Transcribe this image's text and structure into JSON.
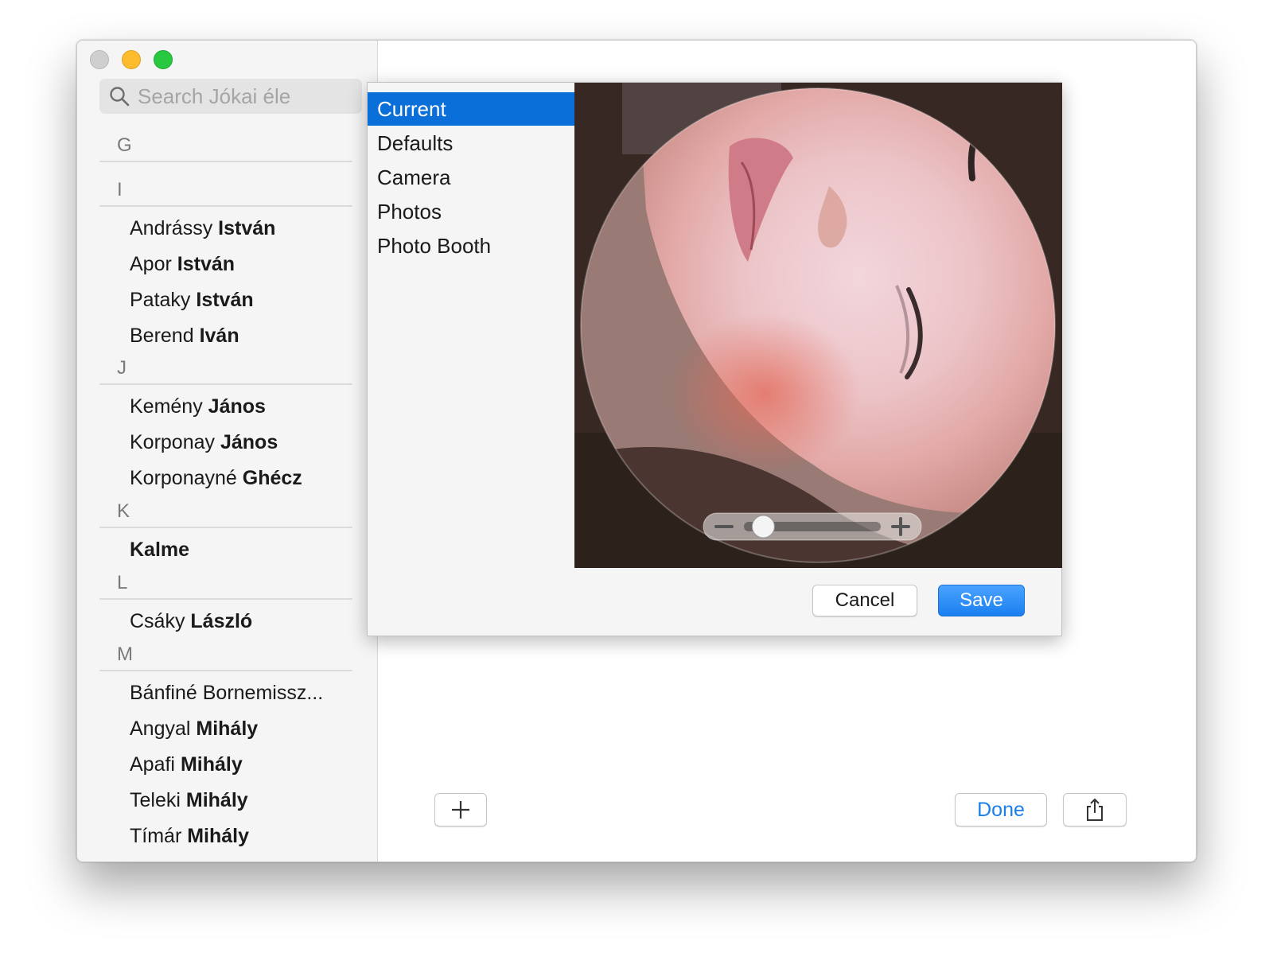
{
  "search": {
    "placeholder": "Search Jókai éle"
  },
  "contacts": {
    "sections": [
      {
        "letter": "G",
        "entries": []
      },
      {
        "letter": "I",
        "entries": [
          {
            "first": "Andrássy ",
            "last": "István"
          },
          {
            "first": "Apor ",
            "last": "István"
          },
          {
            "first": "Pataky ",
            "last": "István"
          },
          {
            "first": "Berend ",
            "last": "Iván"
          }
        ]
      },
      {
        "letter": "J",
        "entries": [
          {
            "first": "Kemény ",
            "last": "János"
          },
          {
            "first": "Korponay ",
            "last": "János"
          },
          {
            "first": "Korponayné ",
            "last": "Ghécz"
          }
        ]
      },
      {
        "letter": "K",
        "entries": [
          {
            "first": "",
            "last": "Kalme"
          }
        ]
      },
      {
        "letter": "L",
        "entries": [
          {
            "first": "Csáky ",
            "last": "László"
          }
        ]
      },
      {
        "letter": "M",
        "entries": [
          {
            "first": "Bánfiné Bornemissz...",
            "last": ""
          },
          {
            "first": "Angyal ",
            "last": "Mihály"
          },
          {
            "first": "Apafi ",
            "last": "Mihály"
          },
          {
            "first": "Teleki ",
            "last": "Mihály"
          },
          {
            "first": "Tímár ",
            "last": "Mihály"
          }
        ]
      }
    ]
  },
  "picker": {
    "sources": [
      "Current",
      "Defaults",
      "Camera",
      "Photos",
      "Photo Booth"
    ],
    "selected_index": 0,
    "zoom_level": 0.1,
    "zoom_minus_icon": "minus",
    "zoom_plus_icon": "plus",
    "cancel_label": "Cancel",
    "save_label": "Save"
  },
  "toolbar": {
    "add_icon": "plus-icon",
    "done_label": "Done",
    "share_icon": "share-icon"
  },
  "colors": {
    "accent": "#0a6fd8",
    "save_button": "#1a7ff0",
    "done_text": "#1a7fe8",
    "traffic_close": "#cfcfcf",
    "traffic_minimize": "#fdbc2e",
    "traffic_zoom": "#28c840"
  }
}
